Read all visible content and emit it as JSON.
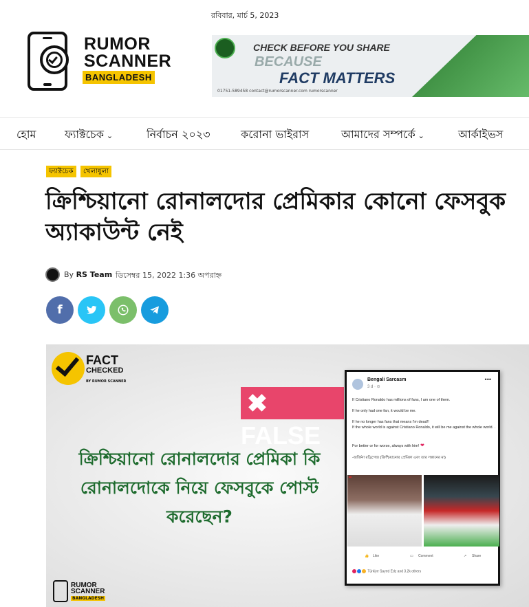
{
  "header": {
    "date": "রবিবার, মার্চ 5, 2023",
    "logo": {
      "line1": "RUMOR",
      "line2": "SCANNER",
      "line3": "BANGLADESH"
    },
    "banner": {
      "line1": "CHECK BEFORE YOU SHARE",
      "line2": "BECAUSE",
      "line3": "FACT MATTERS",
      "contact": "01751-589458  contact@rumorscanner.com  rumorscanner"
    }
  },
  "nav": {
    "items": [
      {
        "label": "হোম"
      },
      {
        "label": "ফ্যাক্টচেক",
        "chevron": "⌄"
      },
      {
        "label": "নির্বাচন ২০২৩"
      },
      {
        "label": "করোনা ভাইরাস"
      },
      {
        "label": "আমাদের সম্পর্কে",
        "chevron": "⌄"
      },
      {
        "label": "আর্কাইভস"
      }
    ]
  },
  "article": {
    "tags": [
      "ফ্যাক্টচেক",
      "খেলাধুলা"
    ],
    "title": "ক্রিশ্চিয়ানো রোনালদোর প্রেমিকার কোনো ফেসবুক অ্যাকাউন্ট নেই",
    "by": "By",
    "author": "RS Team",
    "datetime": "ডিসেম্বর 15, 2022 1:36 অপরাহ্ন",
    "share_icons": [
      "facebook-icon",
      "twitter-icon",
      "whatsapp-icon",
      "telegram-icon"
    ]
  },
  "featured": {
    "fact": "FACT",
    "checked": "CHECKED",
    "by_line": "BY RUMOR SCANNER",
    "verdict": "FALSE",
    "question": "ক্রিশ্চিয়ানো রোনালদোর প্রেমিকা কি রোনালদোকে নিয়ে ফেসবুকে পোস্ট করেছেন?",
    "watermark": {
      "line1": "RUMOR",
      "line2": "SCANNER",
      "line3": "BANGLADESH"
    },
    "post": {
      "name": "Bengali Sarcasm",
      "time": "3 d · ⊙",
      "lines": [
        "If Cristiano Ronaldo has millions of fans, I am one of them.",
        "If he only had one fan, it would be me.",
        "If he no longer has fans that means I'm dead!!",
        "If the whole world is against Cristiano Ronaldo, it will be me against the whole world. .",
        "For better or for worse, always with him!",
        "-জর্জিনা রড্রিগেজ (ক্রিশ্চিয়ানোর প্রেমিকা এবং তার সন্তানের মা)"
      ],
      "heart": "❤",
      "like": "Like",
      "comment": "Comment",
      "share": "Share",
      "reactions": "Türkiye Sayed Edz and 3.2k others"
    }
  }
}
